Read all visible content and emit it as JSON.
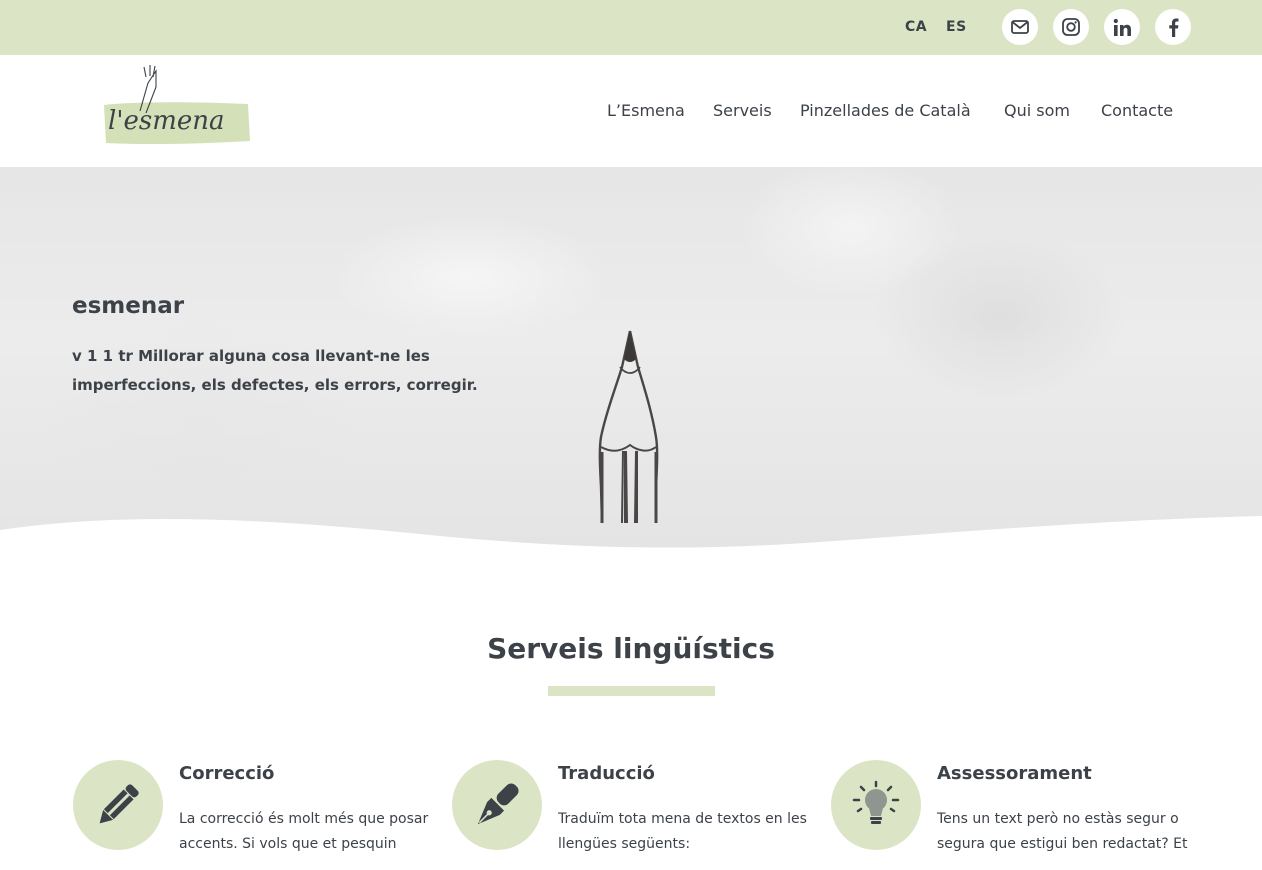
{
  "colors": {
    "accent": "#dbe5c5",
    "text": "#3c4248",
    "icon": "#3c4248"
  },
  "topbar": {
    "languages": [
      "CA",
      "ES"
    ],
    "social": [
      {
        "icon": "envelope-icon"
      },
      {
        "icon": "instagram-icon"
      },
      {
        "icon": "linkedin-icon"
      },
      {
        "icon": "facebook-icon"
      }
    ]
  },
  "header": {
    "logo_text": "l'esmena",
    "nav": [
      "L’Esmena",
      "Serveis",
      "Pinzellades de Català",
      "Qui som",
      "Contacte"
    ]
  },
  "hero": {
    "title": "esmenar",
    "definition": "v 1 1 tr Millorar alguna cosa llevant-ne les imperfeccions, els defectes, els errors, corregir."
  },
  "services_section": {
    "title": "Serveis lingüístics",
    "items": [
      {
        "icon": "pencil-icon",
        "title": "Correcció",
        "text": "La correcció és molt més que posar accents. Si vols que et pesquin"
      },
      {
        "icon": "fountain-pen-icon",
        "title": "Traducció",
        "text": "Traduïm tota mena de textos en les llengües següents:"
      },
      {
        "icon": "lightbulb-icon",
        "title": "Assessorament",
        "text": "Tens un text però no estàs segur o segura que estigui ben redactat? Et"
      }
    ]
  }
}
